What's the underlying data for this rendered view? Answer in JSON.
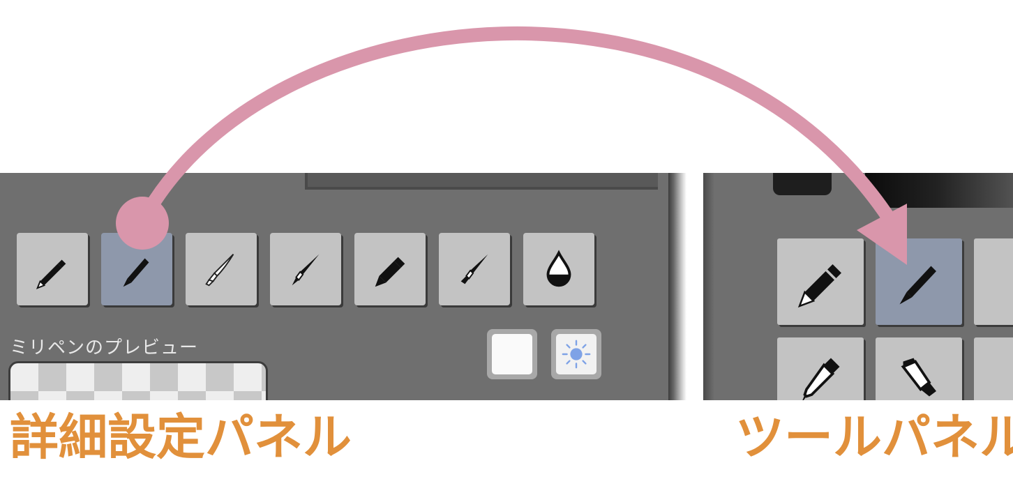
{
  "detail_panel": {
    "preview_label": "ミリペンのプレビュー",
    "tools": [
      {
        "icon": "pencil-icon",
        "selected": false
      },
      {
        "icon": "millipen-icon",
        "selected": true
      },
      {
        "icon": "watercolor-brush-icon",
        "selected": false
      },
      {
        "icon": "pen-brush-icon",
        "selected": false
      },
      {
        "icon": "marker-icon",
        "selected": false
      },
      {
        "icon": "flat-brush-icon",
        "selected": false
      },
      {
        "icon": "water-drop-icon",
        "selected": false
      }
    ],
    "background_toggles": [
      {
        "icon": "white-background-icon"
      },
      {
        "icon": "light-background-icon"
      }
    ]
  },
  "tool_panel": {
    "tools": [
      {
        "icon": "pencil-icon",
        "selected": false
      },
      {
        "icon": "millipen-icon",
        "selected": true
      },
      {
        "icon": "eyedropper-icon",
        "selected": false
      },
      {
        "icon": "paint-tube-icon",
        "selected": false
      }
    ]
  },
  "captions": {
    "left": "詳細設定パネル",
    "right": "ツールパネル"
  },
  "colors": {
    "panel_bg": "#6f6f6f",
    "button_bg": "#c3c3c3",
    "selected_bg": "#8e98ab",
    "arrow": "#d996ab",
    "caption": "#e1903b",
    "sun": "#7ea2e6"
  }
}
